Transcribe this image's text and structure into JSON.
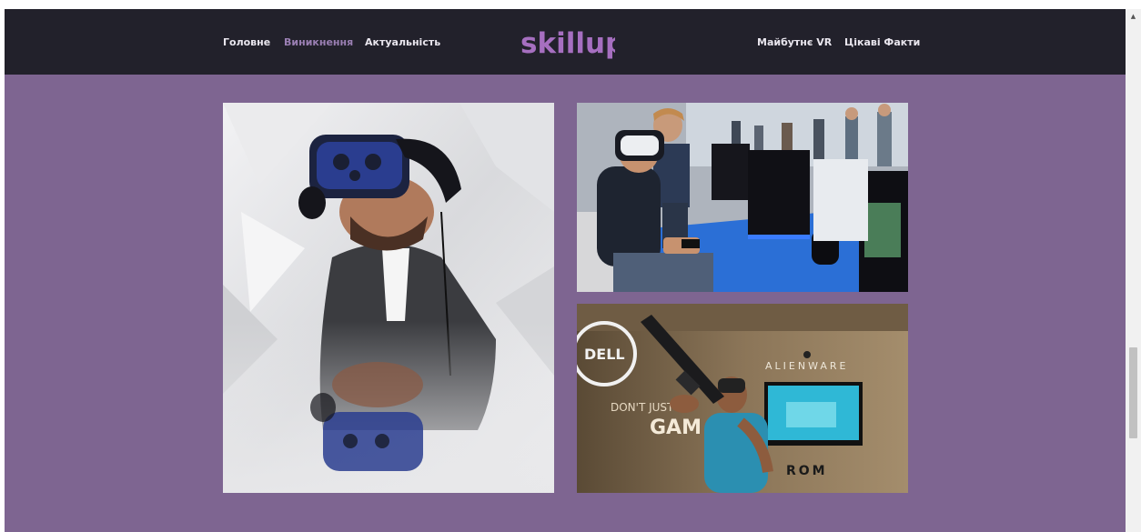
{
  "nav": {
    "items": [
      {
        "label": "Головне"
      },
      {
        "label": "Виникнення"
      },
      {
        "label": "Актуальність"
      },
      {
        "label": "Майбутнє VR"
      },
      {
        "label": "Цікаві Факти"
      }
    ],
    "logo_text": "skillup"
  },
  "gallery": {
    "photos": [
      {
        "alt": "vr-headset-portrait"
      },
      {
        "alt": "vr-gaming-event"
      },
      {
        "alt": "dell-alienware-vr-shooter"
      }
    ],
    "photo3_texts": {
      "brand": "DELL",
      "alienware": "ALIENWARE",
      "slogan_line1": "DON'T JUST",
      "slogan_line2": "GAM",
      "room": "ROM"
    }
  },
  "colors": {
    "page_background": "#7e6591",
    "navbar_background": "#22212b",
    "logo": "#a66fc0",
    "nav_active": "#9a7fb3",
    "nav_text": "#e9e6ee"
  }
}
